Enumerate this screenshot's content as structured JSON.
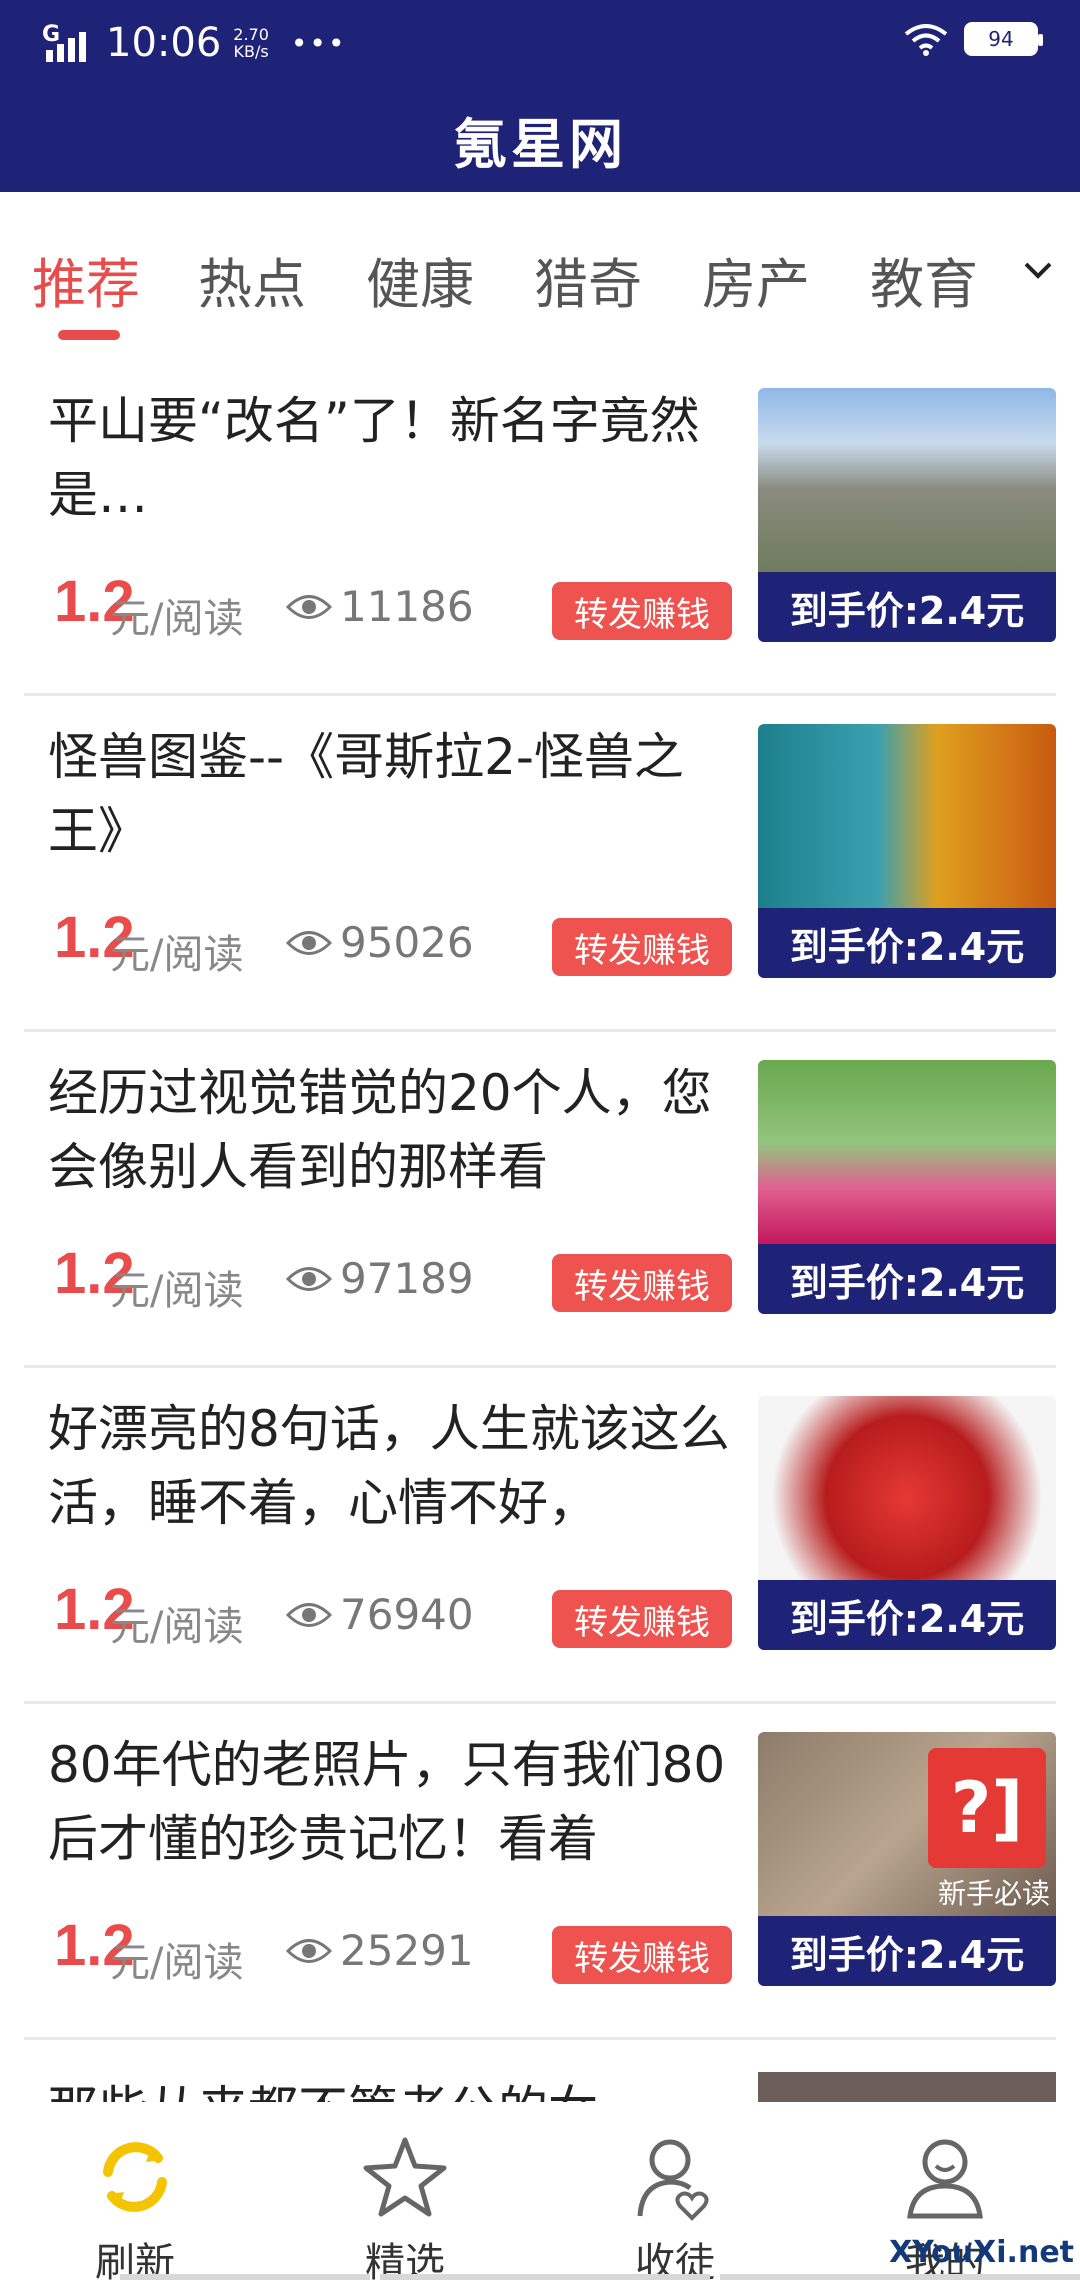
{
  "status_bar": {
    "time": "10:06",
    "speed_value": "2.70",
    "speed_unit": "KB/s",
    "more": "•••",
    "battery": "94"
  },
  "app_title": "氪星网",
  "tabs": [
    "推荐",
    "热点",
    "健康",
    "猎奇",
    "房产",
    "教育"
  ],
  "active_tab": 0,
  "accent_color": "#e84c4c",
  "brand_color": "#1f2377",
  "articles": [
    {
      "title": "平山要“改名”了！新名字竟然是…",
      "price": "1.2",
      "price_unit": "元/阅读",
      "views": "11186",
      "share_label": "转发赚钱",
      "thumb_price": "到手价:2.4元"
    },
    {
      "title": "怪兽图鉴--《哥斯拉2-怪兽之王》",
      "price": "1.2",
      "price_unit": "元/阅读",
      "views": "95026",
      "share_label": "转发赚钱",
      "thumb_price": "到手价:2.4元"
    },
    {
      "title": "经历过视觉错觉的20个人，您会像别人看到的那样看",
      "price": "1.2",
      "price_unit": "元/阅读",
      "views": "97189",
      "share_label": "转发赚钱",
      "thumb_price": "到手价:2.4元"
    },
    {
      "title": "好漂亮的8句话，人生就该这么活，睡不着，心情不好，",
      "price": "1.2",
      "price_unit": "元/阅读",
      "views": "76940",
      "share_label": "转发赚钱",
      "thumb_price": "到手价:2.4元"
    },
    {
      "title": "80年代的老照片，只有我们80后才懂的珍贵记忆！看着",
      "price": "1.2",
      "price_unit": "元/阅读",
      "views": "25291",
      "share_label": "转发赚钱",
      "thumb_price": "到手价:2.4元"
    }
  ],
  "newbie_badge": {
    "symbol": "?]",
    "label": "新手必读"
  },
  "partial_article_title": "那些从来都不管老公的女",
  "bottom_nav": [
    {
      "label": "刷新",
      "icon": "refresh-icon"
    },
    {
      "label": "精选",
      "icon": "star-icon"
    },
    {
      "label": "收徒",
      "icon": "user-heart-icon"
    },
    {
      "label": "我的",
      "icon": "user-icon"
    }
  ],
  "watermark": "XYouXi.net"
}
